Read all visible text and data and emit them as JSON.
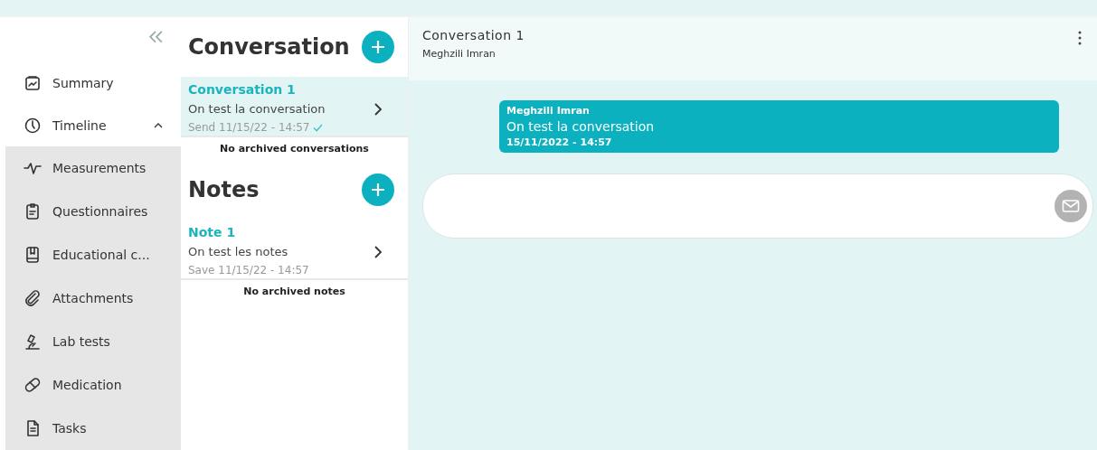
{
  "sidebar": {
    "items": [
      {
        "label": "Summary"
      },
      {
        "label": "Timeline",
        "expanded": true,
        "children": [
          {
            "label": "Measurements"
          },
          {
            "label": "Questionnaires"
          },
          {
            "label": "Educational c..."
          },
          {
            "label": "Attachments"
          },
          {
            "label": "Lab tests"
          },
          {
            "label": "Medication"
          },
          {
            "label": "Tasks"
          }
        ]
      }
    ]
  },
  "lists": [
    {
      "title": "Conversation",
      "items": [
        {
          "title": "Conversation 1",
          "preview": "On test la conversation",
          "meta": "Send 11/15/22 - 14:57",
          "delivered": true,
          "selected": true
        }
      ],
      "archive_note": "No archived conversations"
    },
    {
      "title": "Notes",
      "items": [
        {
          "title": "Note 1",
          "preview": "On test les notes",
          "meta": "Save 11/15/22 - 14:57",
          "delivered": false,
          "selected": false
        }
      ],
      "archive_note": "No archived notes"
    }
  ],
  "chat": {
    "title": "Conversation 1",
    "subtitle": "Meghzili Imran",
    "messages": [
      {
        "author": "Meghzili Imran",
        "text": "On test la conversation",
        "time": "15/11/2022 - 14:57"
      }
    ]
  }
}
